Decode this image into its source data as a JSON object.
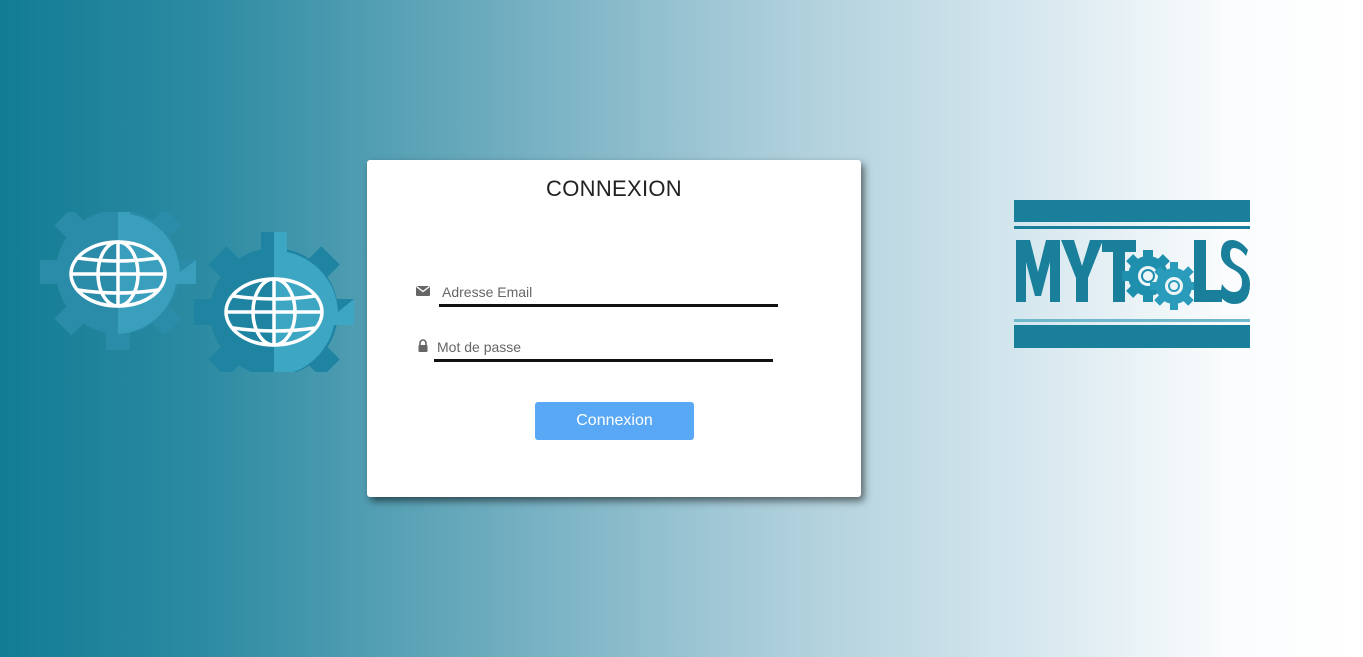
{
  "login": {
    "title": "CONNEXION",
    "email_placeholder": "Adresse Email",
    "password_placeholder": "Mot de passe",
    "submit_label": "Connexion"
  },
  "logo": {
    "text": "MYTOOLS"
  },
  "icons": {
    "email": "envelope-icon",
    "password": "lock-icon",
    "decor": "globe-gears-graphic"
  },
  "colors": {
    "brand": "#127c95",
    "button": "#59a8f5",
    "gear_light": "#3fa6c4",
    "gear_dark": "#1a7f9a"
  }
}
